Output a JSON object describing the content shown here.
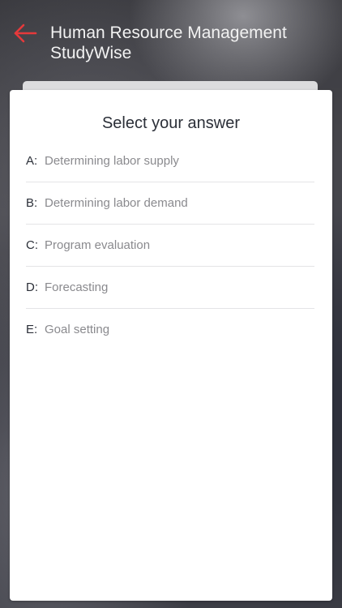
{
  "header": {
    "back_icon": "back-arrow-icon",
    "title": "Human Resource Management StudyWise",
    "accent_color": "#e5393b"
  },
  "question": {
    "prompt": "Select your answer",
    "options": [
      {
        "letter": "A:",
        "text": "Determining labor supply"
      },
      {
        "letter": "B:",
        "text": "Determining labor demand"
      },
      {
        "letter": "C:",
        "text": "Program evaluation"
      },
      {
        "letter": "D:",
        "text": "Forecasting"
      },
      {
        "letter": "E:",
        "text": "Goal setting"
      }
    ]
  }
}
